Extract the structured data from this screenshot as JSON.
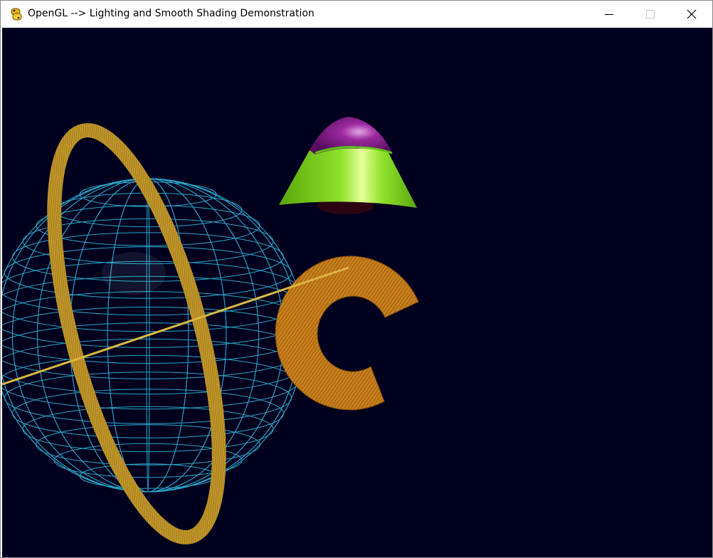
{
  "window": {
    "title": "OpenGL --> Lighting and Smooth Shading Demonstration",
    "icon": "python-snake-icon"
  },
  "title_controls": {
    "minimize_icon": "minimize-icon",
    "maximize_icon": "maximize-icon",
    "close_icon": "close-icon"
  },
  "scene": {
    "background_color": "#00001e",
    "objects": [
      {
        "name": "wireframe-sphere",
        "color": "#2aa6c6",
        "highlight": "#d6f2ff"
      },
      {
        "name": "ring",
        "color": "#c0962a"
      },
      {
        "name": "axis-line",
        "color": "#d9b840"
      },
      {
        "name": "cone",
        "color": "#8ee22a",
        "cap_color": "#8b1f8c"
      },
      {
        "name": "partial-torus",
        "color": "#c97f1c"
      }
    ]
  }
}
